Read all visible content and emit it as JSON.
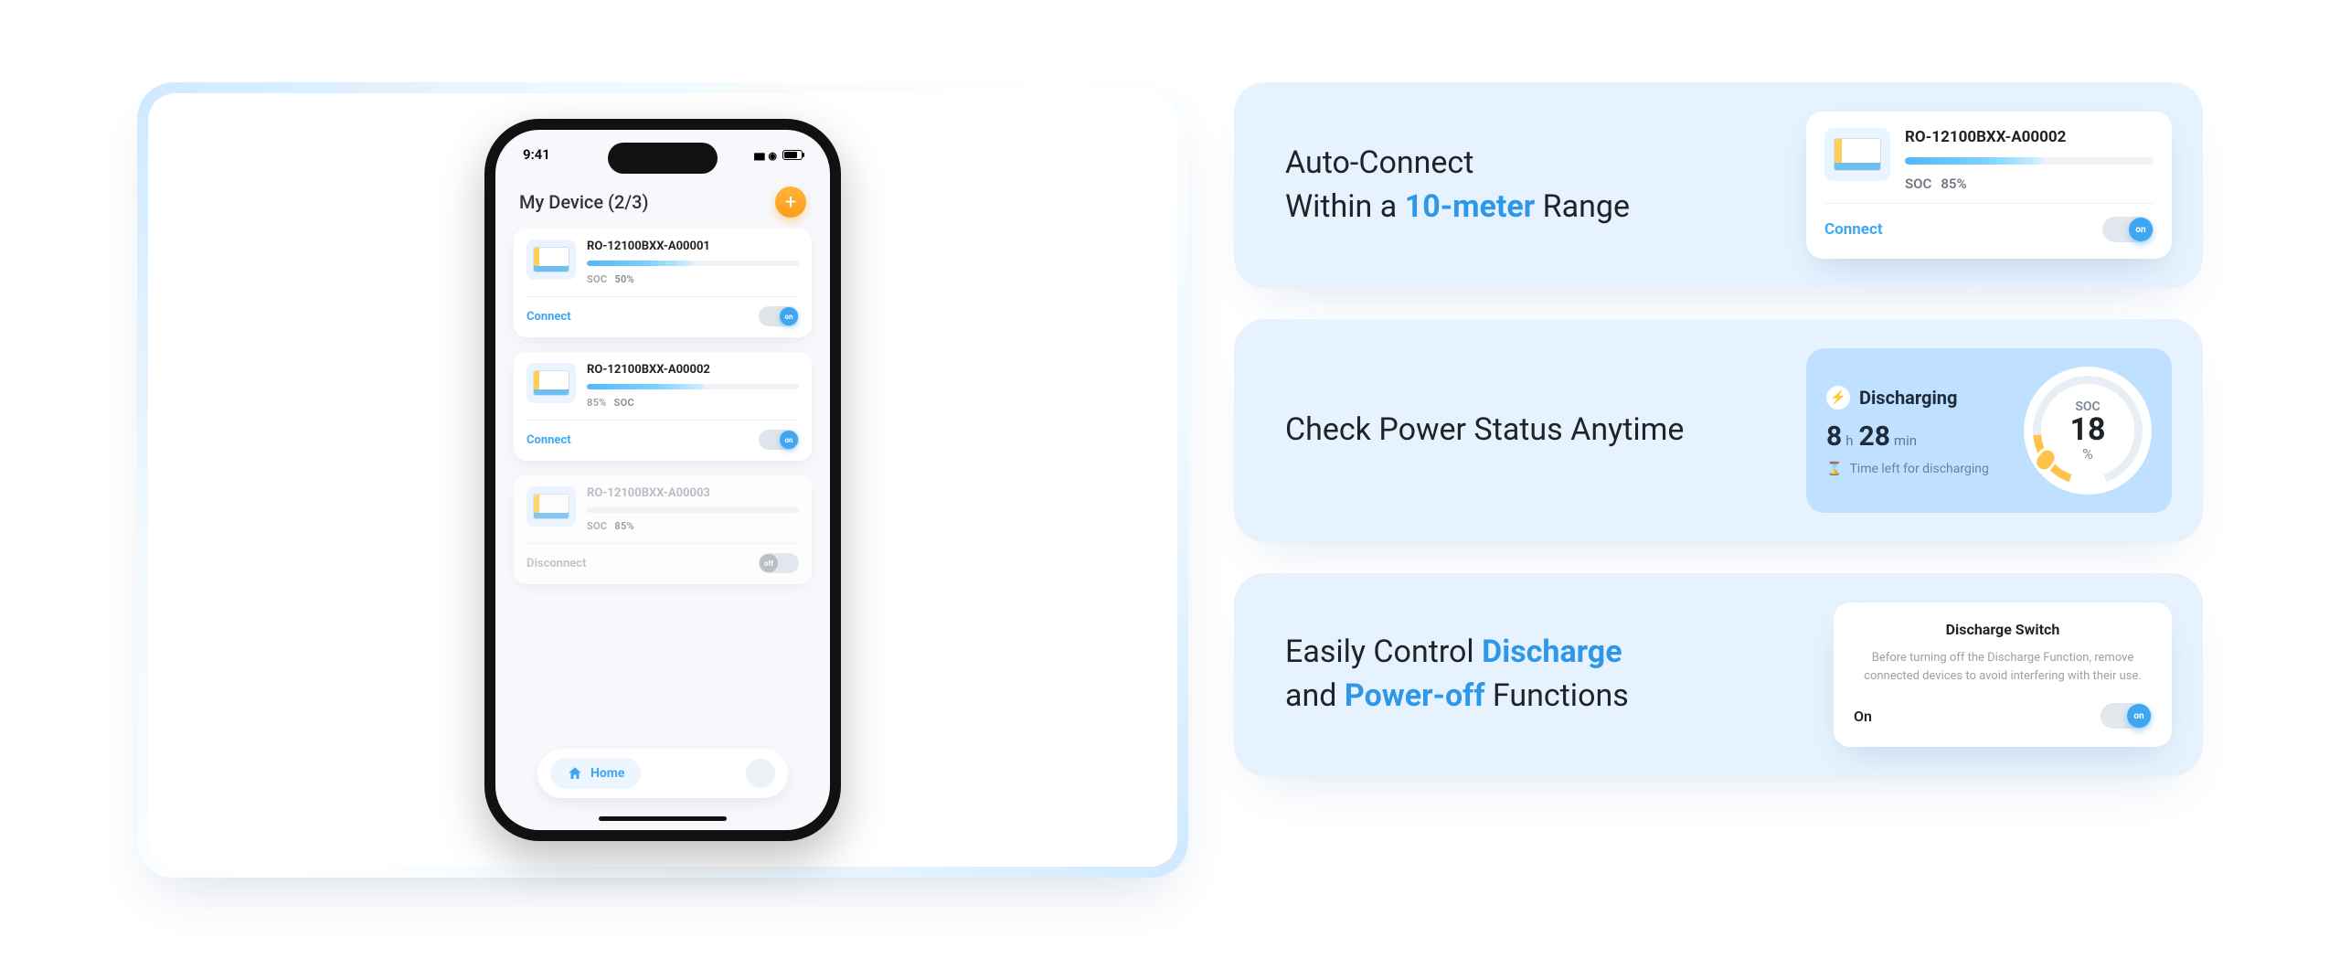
{
  "phone": {
    "status_time": "9:41",
    "header_title": "My Device (2/3)",
    "add_label": "+",
    "devices": [
      {
        "name": "RO-12100BXX-A00001",
        "soc_label": "SOC",
        "soc_value": "50%",
        "progress_pct": 50,
        "connect_label": "Connect",
        "toggle_state": "on",
        "toggle_text": "on"
      },
      {
        "name": "RO-12100BXX-A00002",
        "soc_label": "SOC",
        "soc_value": "85%",
        "soc_order_reversed": true,
        "progress_pct": 55,
        "connect_label": "Connect",
        "toggle_state": "on",
        "toggle_text": "on"
      },
      {
        "name": "RO-12100BXX-A00003",
        "soc_label": "SOC",
        "soc_value": "85%",
        "progress_pct": 0,
        "connect_label": "Disconnect",
        "toggle_state": "off",
        "toggle_text": "off",
        "muted": true
      }
    ],
    "nav_home": "Home"
  },
  "features": {
    "auto_connect": {
      "line1": "Auto-Connect",
      "line2a": "Within a ",
      "highlight": "10-meter",
      "line2b": " Range",
      "card": {
        "name": "RO-12100BXX-A00002",
        "soc_label": "SOC",
        "soc_value": "85%",
        "progress_pct": 55,
        "connect_label": "Connect",
        "toggle_text": "on"
      }
    },
    "power_status": {
      "title": "Check Power Status Anytime",
      "card": {
        "status_label": "Discharging",
        "hours": "8",
        "hours_unit": "h",
        "minutes": "28",
        "minutes_unit": "min",
        "sub_label": "Time left for discharging",
        "gauge_label": "SOC",
        "gauge_value": "18",
        "gauge_pct": "%"
      }
    },
    "discharge_control": {
      "line1a": "Easily Control ",
      "hl1": "Discharge",
      "line2a": "and ",
      "hl2": "Power-off",
      "line2b": " Functions",
      "card": {
        "title": "Discharge Switch",
        "desc": "Before turning off the Discharge Function, remove connected devices to avoid interfering with their use.",
        "state_label": "On",
        "toggle_text": "on"
      }
    }
  }
}
